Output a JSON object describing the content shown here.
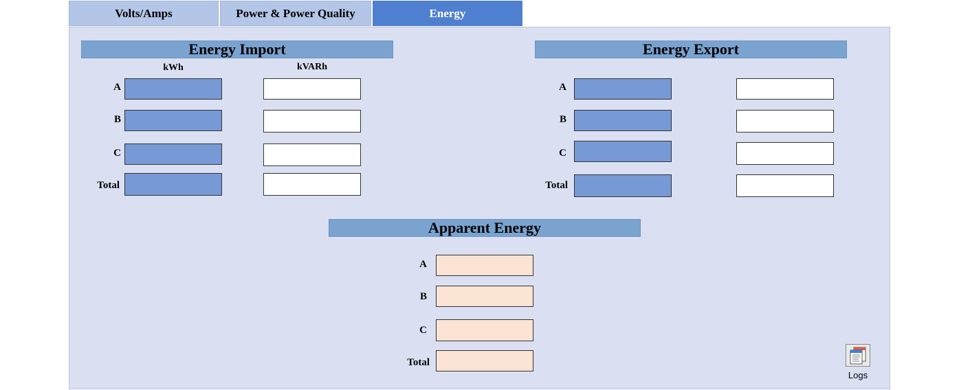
{
  "tabs": [
    {
      "label": "Volts/Amps"
    },
    {
      "label": "Power & Power Quality"
    },
    {
      "label": "Energy"
    }
  ],
  "import": {
    "title": "Energy Import",
    "col_kwh": "kWh",
    "col_kvarh": "kVARh",
    "rows": [
      "A",
      "B",
      "C",
      "Total"
    ],
    "kwh_values": [
      "",
      "",
      "",
      ""
    ],
    "kvarh_values": [
      "",
      "",
      "",
      ""
    ]
  },
  "export": {
    "title": "Energy Export",
    "rows": [
      "A",
      "B",
      "C",
      "Total"
    ],
    "kwh_values": [
      "",
      "",
      "",
      ""
    ],
    "kvarh_values": [
      "",
      "",
      "",
      ""
    ]
  },
  "apparent": {
    "title": "Apparent Energy",
    "rows": [
      "A",
      "B",
      "C",
      "Total"
    ],
    "values": [
      "",
      "",
      "",
      ""
    ]
  },
  "logs": {
    "label": "Logs",
    "icon": "logs-icon"
  },
  "colors": {
    "tab_active": "#4f7fcf",
    "tab_inactive": "#b4c6e7",
    "panel_bg": "#dae0f2",
    "header_bar": "#7aa3d0",
    "field_blue": "#7799d6",
    "field_peach": "#fbe3d4"
  }
}
